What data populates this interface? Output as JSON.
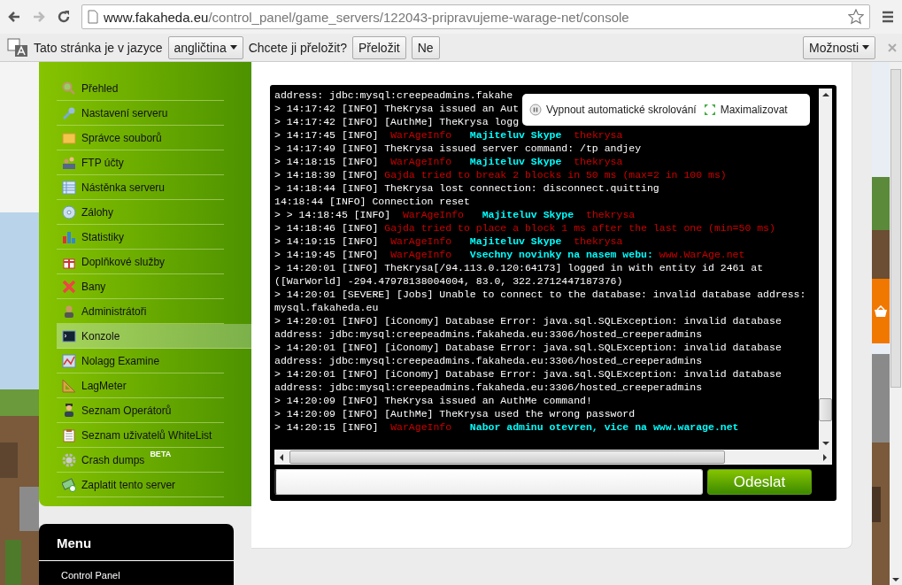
{
  "browser": {
    "url_host": "www.fakaheda.eu",
    "url_path": "/control_panel/game_servers/122043-pripravujeme-warage-net/console",
    "forward_disabled": true
  },
  "translate_bar": {
    "prefix": "Tato stránka je v jazyce",
    "language": "angličtina",
    "question": "Chcete ji přeložit?",
    "buttons": [
      "Přeložit",
      "Ne"
    ],
    "options": "Možnosti"
  },
  "sidebar": {
    "items": [
      {
        "label": "Přehled",
        "selected": false
      },
      {
        "label": "Nastavení serveru",
        "selected": false
      },
      {
        "label": "Správce souborů",
        "selected": false
      },
      {
        "label": "FTP účty",
        "selected": false
      },
      {
        "label": "Nástěnka serveru",
        "selected": false
      },
      {
        "label": "Zálohy",
        "selected": false
      },
      {
        "label": "Statistiky",
        "selected": false
      },
      {
        "label": "Doplňkové služby",
        "selected": false
      },
      {
        "label": "Bany",
        "selected": false
      },
      {
        "label": "Administrátoři",
        "selected": false
      },
      {
        "label": "Konzole",
        "selected": true
      },
      {
        "label": "Nolagg Examine",
        "selected": false
      },
      {
        "label": "LagMeter",
        "selected": false
      },
      {
        "label": "Seznam Operátorů",
        "selected": false
      },
      {
        "label": "Seznam uživatelů WhiteList",
        "selected": false
      },
      {
        "label": "Crash dumps",
        "selected": false,
        "badge": "BETA"
      },
      {
        "label": "Zaplatit tento server",
        "selected": false
      }
    ]
  },
  "menu_box": {
    "title": "Menu",
    "items": [
      "Control Panel"
    ]
  },
  "console": {
    "lines": [
      {
        "segments": [
          {
            "text": "address: jdbc:mysql:creepeadmins.fakahe",
            "color": "#ffffff"
          }
        ]
      },
      {
        "segments": [
          {
            "text": "> 14:17:42 [INFO] TheKrysa issued an Aut",
            "color": "#ffffff"
          }
        ]
      },
      {
        "segments": [
          {
            "text": "> 14:17:42 [INFO] [AuthMe] TheKrysa logg",
            "color": "#ffffff"
          }
        ]
      },
      {
        "segments": [
          {
            "text": "> 14:17:45 [INFO]  ",
            "color": "#ffffff"
          },
          {
            "text": "WarAgeInfo",
            "color": "#cc0000"
          },
          {
            "text": "   Majiteluv Skype",
            "color": "#00ffff"
          },
          {
            "text": "  thekrysa",
            "color": "#cc0000"
          }
        ]
      },
      {
        "segments": [
          {
            "text": "> 14:17:49 [INFO] TheKrysa issued server command: /tp andjey",
            "color": "#ffffff"
          }
        ]
      },
      {
        "segments": [
          {
            "text": "> 14:18:15 [INFO]  ",
            "color": "#ffffff"
          },
          {
            "text": "WarAgeInfo",
            "color": "#cc0000"
          },
          {
            "text": "   Majiteluv Skype",
            "color": "#00ffff"
          },
          {
            "text": "  thekrysa",
            "color": "#cc0000"
          }
        ]
      },
      {
        "segments": [
          {
            "text": "> 14:18:39 [INFO] ",
            "color": "#ffffff"
          },
          {
            "text": "Gajda tried to break 2 blocks in 50 ms (max=2 in 100 ms)",
            "color": "#cc0000"
          }
        ]
      },
      {
        "segments": [
          {
            "text": "> 14:18:44 [INFO] TheKrysa lost connection: disconnect.quitting",
            "color": "#ffffff"
          }
        ]
      },
      {
        "segments": [
          {
            "text": "14:18:44 [INFO] Connection reset",
            "color": "#ffffff"
          }
        ]
      },
      {
        "segments": [
          {
            "text": "> > 14:18:45 [INFO]  ",
            "color": "#ffffff"
          },
          {
            "text": "WarAgeInfo",
            "color": "#cc0000"
          },
          {
            "text": "   Majiteluv Skype",
            "color": "#00ffff"
          },
          {
            "text": "  thekrysa",
            "color": "#cc0000"
          }
        ]
      },
      {
        "segments": [
          {
            "text": "> 14:18:46 [INFO] ",
            "color": "#ffffff"
          },
          {
            "text": "Gajda tried to place a block 1 ms after the last one (min=50 ms)",
            "color": "#cc0000"
          }
        ]
      },
      {
        "segments": [
          {
            "text": "> 14:19:15 [INFO]  ",
            "color": "#ffffff"
          },
          {
            "text": "WarAgeInfo",
            "color": "#cc0000"
          },
          {
            "text": "   Majiteluv Skype",
            "color": "#00ffff"
          },
          {
            "text": "  thekrysa",
            "color": "#cc0000"
          }
        ]
      },
      {
        "segments": [
          {
            "text": "> 14:19:45 [INFO]  ",
            "color": "#ffffff"
          },
          {
            "text": "WarAgeInfo",
            "color": "#cc0000"
          },
          {
            "text": "   Vsechny novinky na nasem webu:",
            "color": "#00ffff"
          },
          {
            "text": " www.WarAge.net",
            "color": "#cc0000"
          }
        ]
      },
      {
        "segments": [
          {
            "text": "> 14:20:01 [INFO] TheKrysa[/94.113.0.120:64173] logged in with entity id 2461 at",
            "color": "#ffffff"
          }
        ]
      },
      {
        "segments": [
          {
            "text": "([WarWorld] -294.47978138004004, 83.0, 322.2712447187376)",
            "color": "#ffffff"
          }
        ]
      },
      {
        "segments": [
          {
            "text": "> 14:20:01 [SEVERE] [Jobs] Unable to connect to the database: invalid database address:",
            "color": "#ffffff"
          }
        ]
      },
      {
        "segments": [
          {
            "text": "mysql.fakaheda.eu",
            "color": "#ffffff"
          }
        ]
      },
      {
        "segments": [
          {
            "text": "> 14:20:01 [INFO] [iConomy] Database Error: java.sql.SQLException: invalid database",
            "color": "#ffffff"
          }
        ]
      },
      {
        "segments": [
          {
            "text": "address: jdbc:mysql:creepeadmins.fakaheda.eu:3306/hosted_creeperadmins",
            "color": "#ffffff"
          }
        ]
      },
      {
        "segments": [
          {
            "text": "> 14:20:01 [INFO] [iConomy] Database Error: java.sql.SQLException: invalid database",
            "color": "#ffffff"
          }
        ]
      },
      {
        "segments": [
          {
            "text": "address: jdbc:mysql:creepeadmins.fakaheda.eu:3306/hosted_creeperadmins",
            "color": "#ffffff"
          }
        ]
      },
      {
        "segments": [
          {
            "text": "> 14:20:01 [INFO] [iConomy] Database Error: java.sql.SQLException: invalid database",
            "color": "#ffffff"
          }
        ]
      },
      {
        "segments": [
          {
            "text": "address: jdbc:mysql:creepeadmins.fakaheda.eu:3306/hosted_creeperadmins",
            "color": "#ffffff"
          }
        ]
      },
      {
        "segments": [
          {
            "text": "> 14:20:09 [INFO] TheKrysa issued an AuthMe command!",
            "color": "#ffffff"
          }
        ]
      },
      {
        "segments": [
          {
            "text": "> 14:20:09 [INFO] [AuthMe] TheKrysa used the wrong password",
            "color": "#ffffff"
          }
        ]
      },
      {
        "segments": [
          {
            "text": "> 14:20:15 [INFO]  ",
            "color": "#ffffff"
          },
          {
            "text": "WarAgeInfo",
            "color": "#cc0000"
          },
          {
            "text": "   Nabor adminu otevren, vice na www.warage.net",
            "color": "#00ffff"
          }
        ]
      }
    ],
    "overlay": {
      "autoscroll_label": "Vypnout automatické skrolování",
      "maximize_label": "Maximalizovat"
    },
    "send_button": "Odeslat"
  }
}
